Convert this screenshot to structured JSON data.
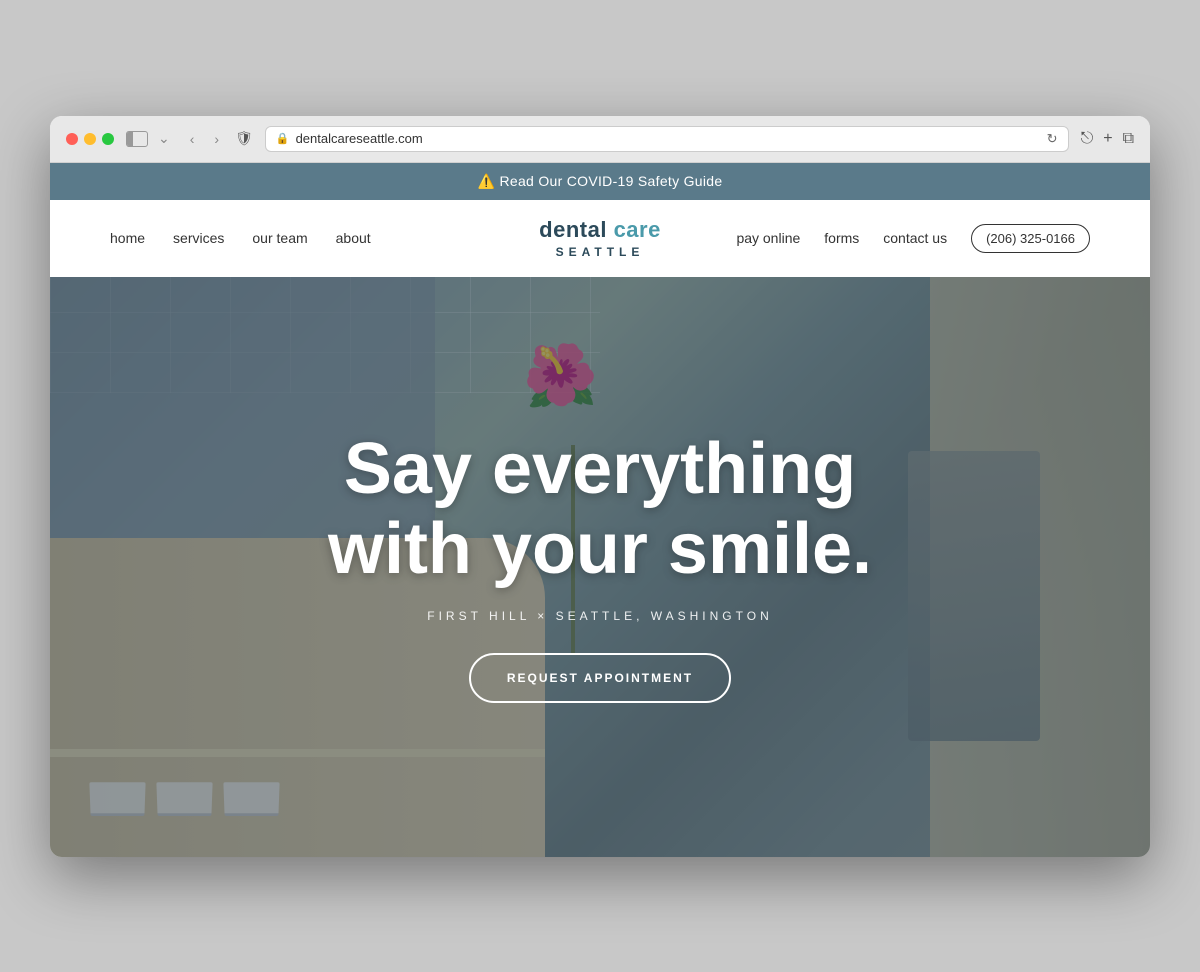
{
  "browser": {
    "url": "dentalcareseattle.com",
    "tab_chevron": "⌄"
  },
  "covid_banner": {
    "icon": "⚠️",
    "text": "Read Our COVID-19 Safety Guide"
  },
  "nav": {
    "left_links": [
      "home",
      "services",
      "our team",
      "about"
    ],
    "logo_dental": "dental ",
    "logo_care": "care",
    "logo_seattle": "SEATTLE",
    "right_links": [
      "pay online",
      "forms",
      "contact us"
    ],
    "phone": "(206) 325-0166"
  },
  "hero": {
    "headline_line1": "Say everything",
    "headline_line2": "with your smile.",
    "location": "FIRST HILL × SEATTLE, WASHINGTON",
    "cta_button": "REQUEST APPOINTMENT"
  }
}
